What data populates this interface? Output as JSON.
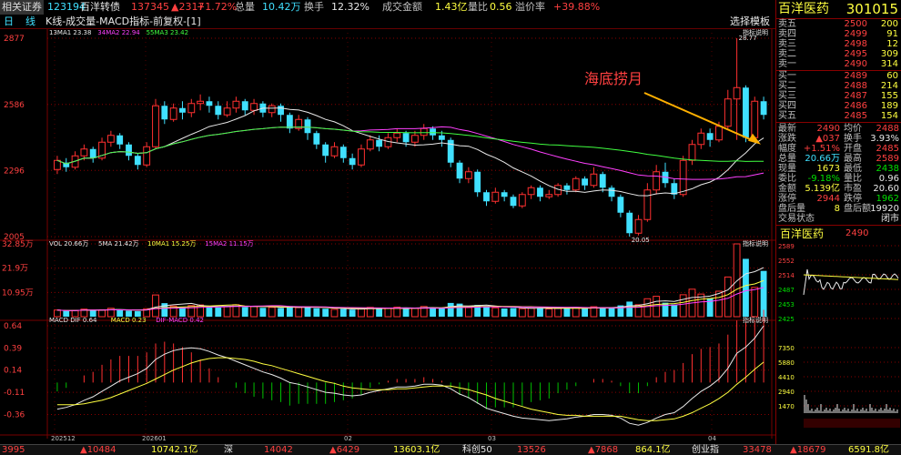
{
  "quote_bar": {
    "broker": "相关证券",
    "bond_code": "123194",
    "bond_name": "百洋转债",
    "bond_price": "137345",
    "bond_chg": "▲2317",
    "bond_pct": "+1.72%",
    "total_label": "总量",
    "total_val": "10.42万",
    "turnover_label": "换手",
    "turnover_val": "12.32%",
    "amount_label": "成交金额",
    "amount_val": "1.43亿",
    "volratio_label": "量比",
    "volratio_val": "0.56",
    "premium_label": "溢价率",
    "premium_val": "+39.88%"
  },
  "title_bar": {
    "period_a": "日",
    "period_b": "线",
    "title": "K线-成交量-MACD指标-前复权-[1]",
    "template_button": "选择模板"
  },
  "main_chart": {
    "ma_legend": [
      "13MA1 23.38",
      "34MA2 22.94",
      "55MA3 23.42"
    ],
    "ind_btn": "指标说明",
    "y_labels": [
      "2877",
      "2586",
      "2296",
      "2005"
    ],
    "high_label": "28.77",
    "low_label": "20.05",
    "annotation": "海底捞月"
  },
  "volume_chart": {
    "legend": [
      "VOL 20.66万",
      "5MA 21.42万",
      "10MA1 15.25万",
      "15MA2 11.15万"
    ],
    "ind_btn": "指标说明",
    "y_labels": [
      "32.85万",
      "21.9万",
      "10.95万"
    ]
  },
  "macd_chart": {
    "legend": [
      "MACD DIF 0.64",
      "MACD 0.23",
      "DIF-MACD 0.42"
    ],
    "ind_btn": "指标说明",
    "y_labels": [
      "0.64",
      "0.39",
      "0.14",
      "-0.11",
      "-0.36"
    ]
  },
  "x_axis": [
    "202512",
    "202601",
    "02",
    "03",
    "04"
  ],
  "right_panel": {
    "stock_name": "百洋医药",
    "stock_code": "301015",
    "asks": [
      {
        "label": "卖五",
        "price": "2500",
        "vol": "200"
      },
      {
        "label": "卖四",
        "price": "2499",
        "vol": "91"
      },
      {
        "label": "卖三",
        "price": "2498",
        "vol": "12"
      },
      {
        "label": "卖二",
        "price": "2495",
        "vol": "309"
      },
      {
        "label": "卖一",
        "price": "2490",
        "vol": "314"
      }
    ],
    "bids": [
      {
        "label": "买一",
        "price": "2489",
        "vol": "60"
      },
      {
        "label": "买二",
        "price": "2488",
        "vol": "214"
      },
      {
        "label": "买三",
        "price": "2487",
        "vol": "155"
      },
      {
        "label": "买四",
        "price": "2486",
        "vol": "189"
      },
      {
        "label": "买五",
        "price": "2485",
        "vol": "154"
      }
    ],
    "stats": [
      {
        "l": "最新",
        "lv": "2490",
        "lc": "red",
        "r": "均价",
        "rv": "2488",
        "rc": "red"
      },
      {
        "l": "涨跌",
        "lv": "▲037",
        "lc": "red",
        "r": "换手",
        "rv": "3.93%",
        "rc": "wht"
      },
      {
        "l": "幅度",
        "lv": "+1.51%",
        "lc": "red",
        "r": "开盘",
        "rv": "2485",
        "rc": "red"
      },
      {
        "l": "总量",
        "lv": "20.66万",
        "lc": "cyn",
        "r": "最高",
        "rv": "2589",
        "rc": "red"
      },
      {
        "l": "现量",
        "lv": "1673",
        "lc": "yel",
        "r": "最低",
        "rv": "2438",
        "rc": "grn"
      },
      {
        "l": "委比",
        "lv": "-9.18%",
        "lc": "grn",
        "r": "量比",
        "rv": "0.96",
        "rc": "wht"
      },
      {
        "l": "金额",
        "lv": "5.139亿",
        "lc": "yel",
        "r": "市盈",
        "rv": "20.60",
        "rc": "wht"
      },
      {
        "l": "涨停",
        "lv": "2944",
        "lc": "red",
        "r": "跌停",
        "rv": "1962",
        "rc": "grn"
      },
      {
        "l": "盘后量",
        "lv": "8",
        "lc": "yel",
        "r": "盘后额",
        "rv": "19920",
        "rc": "wht"
      }
    ],
    "trade_state_label": "交易状态",
    "trade_state": "闭市",
    "mini_name": "百洋医药",
    "mini_price": "2490",
    "mini_y_labels": [
      "2589",
      "2552",
      "2514",
      "2487",
      "2453",
      "2425"
    ],
    "mini_vol_labels": [
      "7350",
      "5880",
      "4410",
      "2940",
      "1470"
    ]
  },
  "bottom_bar": [
    {
      "text": "3995",
      "cls": "red"
    },
    {
      "text": "▲10484",
      "cls": "red"
    },
    {
      "text": "10742.1亿",
      "cls": "yel"
    },
    {
      "text": "深",
      "cls": "wht"
    },
    {
      "text": "14042",
      "cls": "red"
    },
    {
      "text": "▲6429",
      "cls": "red"
    },
    {
      "text": "13603.1亿",
      "cls": "yel"
    },
    {
      "text": "科创50",
      "cls": "wht"
    },
    {
      "text": "13526",
      "cls": "red"
    },
    {
      "text": "▲7868",
      "cls": "red"
    },
    {
      "text": "864.1亿",
      "cls": "yel"
    },
    {
      "text": "创业指",
      "cls": "wht"
    },
    {
      "text": "33478",
      "cls": "red"
    },
    {
      "text": "▲18679",
      "cls": "red"
    },
    {
      "text": "6591.8亿",
      "cls": "yel"
    }
  ],
  "colors": {
    "up": "#ff3030",
    "down": "#40e0ff",
    "ma1": "#e8e8e8",
    "ma2": "#ff40ff",
    "ma3": "#40ff40",
    "annot": "#ff4040",
    "arrow": "#ffb000"
  },
  "chart_data": {
    "type": "candlestick",
    "y_range": [
      20.05,
      28.77
    ],
    "candles": [
      [
        23.0,
        23.4,
        22.8,
        23.6
      ],
      [
        23.3,
        23.1,
        22.9,
        23.5
      ],
      [
        23.1,
        23.6,
        23.0,
        23.8
      ],
      [
        23.6,
        23.9,
        23.4,
        24.1
      ],
      [
        23.9,
        23.5,
        23.3,
        24.0
      ],
      [
        23.5,
        24.2,
        23.4,
        24.4
      ],
      [
        24.2,
        24.5,
        24.0,
        24.7
      ],
      [
        24.5,
        24.1,
        23.9,
        24.6
      ],
      [
        24.1,
        23.6,
        23.4,
        24.2
      ],
      [
        23.6,
        23.2,
        23.0,
        23.7
      ],
      [
        23.2,
        24.0,
        23.1,
        24.2
      ],
      [
        24.0,
        25.8,
        23.9,
        26.1
      ],
      [
        25.8,
        25.2,
        25.0,
        26.0
      ],
      [
        25.2,
        25.7,
        25.1,
        25.9
      ],
      [
        25.7,
        25.5,
        25.2,
        26.0
      ],
      [
        25.5,
        25.9,
        25.3,
        26.1
      ],
      [
        25.9,
        26.0,
        25.6,
        26.3
      ],
      [
        26.0,
        25.8,
        25.5,
        26.2
      ],
      [
        25.8,
        25.4,
        25.2,
        26.0
      ],
      [
        25.4,
        25.7,
        25.3,
        26.0
      ],
      [
        25.7,
        26.0,
        25.5,
        26.2
      ],
      [
        26.0,
        25.6,
        25.4,
        26.1
      ],
      [
        25.6,
        25.9,
        25.4,
        26.1
      ],
      [
        25.9,
        25.5,
        25.3,
        26.0
      ],
      [
        25.5,
        25.8,
        25.3,
        25.9
      ],
      [
        25.8,
        25.4,
        25.1,
        25.9
      ],
      [
        25.4,
        24.8,
        24.6,
        25.5
      ],
      [
        24.8,
        25.2,
        24.7,
        25.4
      ],
      [
        25.2,
        24.6,
        24.3,
        25.3
      ],
      [
        24.6,
        24.1,
        23.9,
        24.7
      ],
      [
        24.1,
        23.6,
        23.3,
        24.2
      ],
      [
        23.6,
        24.0,
        23.5,
        24.2
      ],
      [
        24.0,
        23.5,
        23.3,
        24.1
      ],
      [
        23.5,
        23.2,
        23.0,
        23.7
      ],
      [
        23.2,
        23.9,
        23.1,
        24.1
      ],
      [
        23.9,
        24.3,
        23.8,
        24.5
      ],
      [
        24.3,
        24.0,
        23.8,
        24.5
      ],
      [
        24.0,
        24.4,
        23.9,
        24.6
      ],
      [
        24.4,
        24.6,
        24.2,
        24.8
      ],
      [
        24.6,
        24.2,
        24.0,
        24.7
      ],
      [
        24.2,
        24.5,
        24.0,
        24.7
      ],
      [
        24.5,
        24.8,
        24.3,
        25.0
      ],
      [
        24.8,
        24.5,
        24.3,
        24.9
      ],
      [
        24.5,
        24.3,
        24.0,
        24.7
      ],
      [
        24.3,
        23.3,
        23.1,
        24.4
      ],
      [
        23.3,
        22.6,
        22.4,
        23.4
      ],
      [
        22.6,
        22.9,
        22.4,
        23.1
      ],
      [
        22.9,
        22.0,
        21.8,
        23.0
      ],
      [
        22.0,
        21.6,
        21.4,
        22.1
      ],
      [
        21.6,
        22.0,
        21.5,
        22.2
      ],
      [
        22.0,
        21.8,
        21.6,
        22.1
      ],
      [
        21.8,
        21.4,
        21.3,
        21.9
      ],
      [
        21.4,
        21.9,
        21.3,
        22.0
      ],
      [
        21.9,
        22.2,
        21.7,
        22.3
      ],
      [
        22.2,
        21.8,
        21.6,
        22.3
      ],
      [
        21.8,
        21.9,
        21.7,
        22.1
      ],
      [
        21.9,
        22.3,
        21.8,
        22.4
      ],
      [
        22.3,
        22.1,
        21.9,
        22.4
      ],
      [
        22.1,
        22.6,
        22.0,
        22.7
      ],
      [
        22.6,
        22.3,
        22.1,
        22.7
      ],
      [
        22.3,
        22.8,
        22.2,
        23.1
      ],
      [
        22.8,
        22.2,
        22.0,
        22.9
      ],
      [
        22.2,
        21.8,
        21.6,
        22.3
      ],
      [
        21.8,
        21.1,
        20.9,
        21.9
      ],
      [
        21.1,
        20.2,
        20.05,
        21.2
      ],
      [
        20.2,
        20.8,
        20.1,
        21.0
      ],
      [
        20.8,
        22.1,
        20.7,
        22.4
      ],
      [
        22.1,
        22.9,
        21.9,
        23.2
      ],
      [
        22.9,
        22.4,
        22.2,
        23.3
      ],
      [
        22.4,
        21.9,
        21.7,
        22.6
      ],
      [
        21.9,
        23.4,
        21.8,
        23.6
      ],
      [
        23.4,
        24.1,
        23.2,
        24.3
      ],
      [
        24.1,
        24.6,
        23.9,
        24.8
      ],
      [
        24.6,
        24.3,
        24.0,
        24.8
      ],
      [
        24.3,
        24.9,
        24.2,
        25.1
      ],
      [
        24.9,
        26.1,
        24.8,
        26.5
      ],
      [
        26.1,
        26.6,
        24.3,
        28.77
      ],
      [
        26.6,
        24.4,
        24.2,
        26.7
      ],
      [
        24.4,
        26.0,
        24.3,
        26.2
      ],
      [
        26.0,
        25.4,
        25.2,
        26.2
      ]
    ],
    "volume_max": 32.85,
    "volumes": [
      3.0,
      2.6,
      2.8,
      3.4,
      2.9,
      3.1,
      3.8,
      3.0,
      2.7,
      2.5,
      3.6,
      9.8,
      6.1,
      4.8,
      4.2,
      5.0,
      5.3,
      4.6,
      4.1,
      4.5,
      5.4,
      4.3,
      4.6,
      4.0,
      4.2,
      3.9,
      4.8,
      4.1,
      4.4,
      3.8,
      3.6,
      3.3,
      3.5,
      3.2,
      3.6,
      4.2,
      3.8,
      3.9,
      4.3,
      3.7,
      3.9,
      4.6,
      4.1,
      3.8,
      6.2,
      5.9,
      4.1,
      5.3,
      4.8,
      4.0,
      3.7,
      3.9,
      3.6,
      3.8,
      4.0,
      3.5,
      3.7,
      3.9,
      4.2,
      3.8,
      4.5,
      4.1,
      4.0,
      5.1,
      6.8,
      5.4,
      8.1,
      9.2,
      6.3,
      5.5,
      9.9,
      12.4,
      10.2,
      8.3,
      11.5,
      17.9,
      32.85,
      26.1,
      13.2,
      20.66
    ],
    "macd_range": [
      -0.55,
      0.66
    ],
    "dif": [
      -0.3,
      -0.28,
      -0.25,
      -0.2,
      -0.16,
      -0.1,
      -0.04,
      0.02,
      0.06,
      0.1,
      0.16,
      0.26,
      0.32,
      0.36,
      0.38,
      0.39,
      0.38,
      0.35,
      0.31,
      0.28,
      0.24,
      0.2,
      0.16,
      0.12,
      0.09,
      0.05,
      0.0,
      -0.02,
      -0.05,
      -0.08,
      -0.11,
      -0.12,
      -0.14,
      -0.15,
      -0.14,
      -0.11,
      -0.09,
      -0.07,
      -0.05,
      -0.05,
      -0.04,
      -0.02,
      -0.02,
      -0.03,
      -0.07,
      -0.13,
      -0.17,
      -0.23,
      -0.29,
      -0.32,
      -0.35,
      -0.38,
      -0.4,
      -0.41,
      -0.42,
      -0.43,
      -0.42,
      -0.41,
      -0.39,
      -0.38,
      -0.36,
      -0.36,
      -0.37,
      -0.4,
      -0.46,
      -0.48,
      -0.45,
      -0.4,
      -0.36,
      -0.34,
      -0.27,
      -0.18,
      -0.1,
      -0.04,
      0.04,
      0.16,
      0.33,
      0.4,
      0.5,
      0.64
    ],
    "dea": [
      -0.25,
      -0.25,
      -0.25,
      -0.24,
      -0.22,
      -0.2,
      -0.17,
      -0.13,
      -0.09,
      -0.05,
      -0.01,
      0.04,
      0.09,
      0.14,
      0.18,
      0.22,
      0.25,
      0.27,
      0.28,
      0.28,
      0.27,
      0.26,
      0.24,
      0.21,
      0.19,
      0.16,
      0.13,
      0.1,
      0.07,
      0.04,
      0.01,
      -0.01,
      -0.04,
      -0.06,
      -0.07,
      -0.08,
      -0.08,
      -0.08,
      -0.07,
      -0.07,
      -0.06,
      -0.05,
      -0.04,
      -0.04,
      -0.04,
      -0.06,
      -0.08,
      -0.11,
      -0.14,
      -0.18,
      -0.21,
      -0.24,
      -0.27,
      -0.3,
      -0.32,
      -0.34,
      -0.36,
      -0.37,
      -0.37,
      -0.38,
      -0.38,
      -0.38,
      -0.38,
      -0.38,
      -0.4,
      -0.42,
      -0.43,
      -0.43,
      -0.42,
      -0.41,
      -0.38,
      -0.34,
      -0.29,
      -0.24,
      -0.18,
      -0.11,
      -0.02,
      0.06,
      0.15,
      0.23
    ]
  }
}
